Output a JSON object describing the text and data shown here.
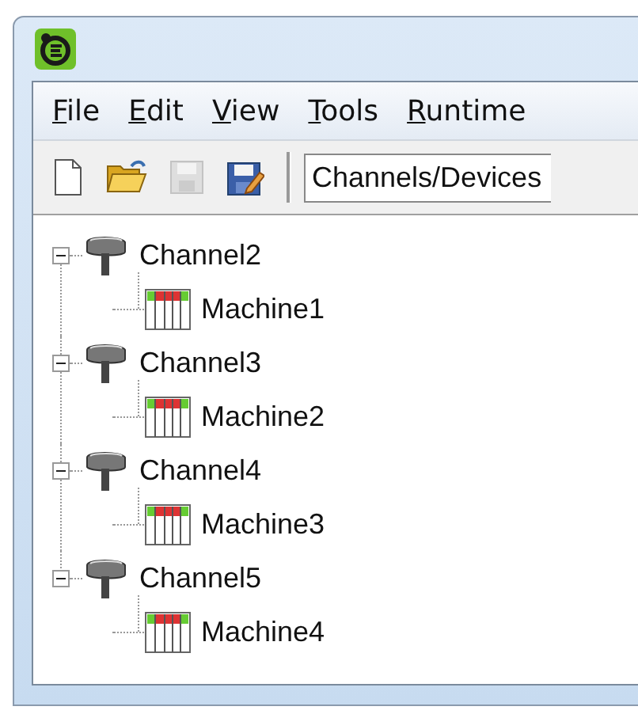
{
  "menu": [
    {
      "label": "File"
    },
    {
      "label": "Edit"
    },
    {
      "label": "View"
    },
    {
      "label": "Tools"
    },
    {
      "label": "Runtime"
    }
  ],
  "toolbar": {
    "buttons": [
      {
        "kind": "new",
        "disabled": false
      },
      {
        "kind": "open",
        "disabled": false
      },
      {
        "kind": "save",
        "disabled": true
      },
      {
        "kind": "saveas",
        "disabled": false
      }
    ],
    "view_selector": {
      "value": "Channels/Devices"
    }
  },
  "tree": [
    {
      "label": "Channel2",
      "expanded": true,
      "children": [
        {
          "label": "Machine1"
        }
      ]
    },
    {
      "label": "Channel3",
      "expanded": true,
      "children": [
        {
          "label": "Machine2"
        }
      ]
    },
    {
      "label": "Channel4",
      "expanded": true,
      "children": [
        {
          "label": "Machine3"
        }
      ]
    },
    {
      "label": "Channel5",
      "expanded": true,
      "children": [
        {
          "label": "Machine4"
        }
      ]
    }
  ]
}
